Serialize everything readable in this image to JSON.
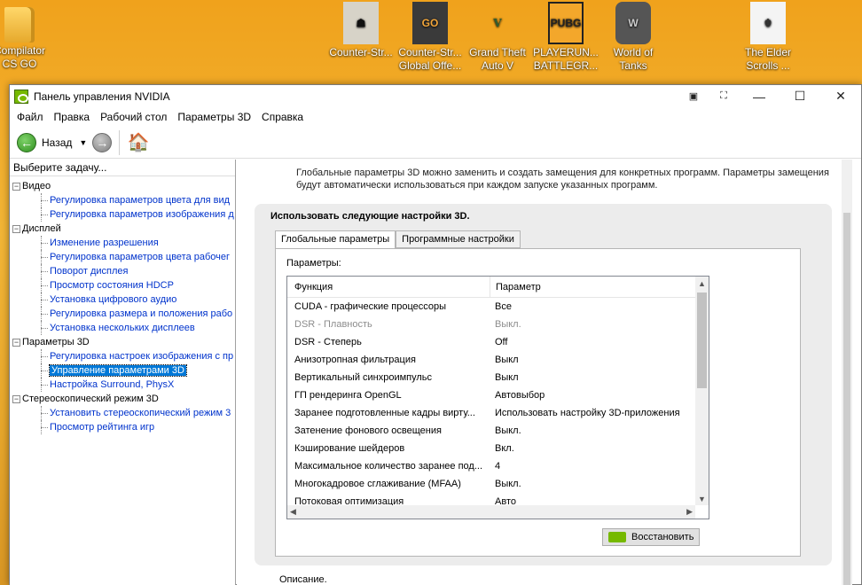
{
  "desktop": {
    "icons": [
      {
        "label": "Compilator\nCS GO",
        "icon": "folder-icon"
      },
      {
        "label": "Counter-Str...",
        "icon": "counter-strike-icon"
      },
      {
        "label": "Counter-Str...\nGlobal Offe...",
        "icon": "csgo-icon"
      },
      {
        "label": "Grand Theft\nAuto V",
        "icon": "gta-v-icon"
      },
      {
        "label": "PLAYERUN...\nBATTLEGR...",
        "icon": "pubg-icon"
      },
      {
        "label": "World of\nTanks",
        "icon": "world-of-tanks-icon"
      },
      {
        "label": "The Elder\nScrolls ...",
        "icon": "elder-scrolls-icon"
      }
    ]
  },
  "window": {
    "title": "Панель управления NVIDIA",
    "menu": [
      "Файл",
      "Правка",
      "Рабочий стол",
      "Параметры 3D",
      "Справка"
    ],
    "toolbar": {
      "back_label": "Назад"
    }
  },
  "left": {
    "header": "Выберите задачу...",
    "tree": [
      {
        "type": "cat",
        "label": "Видео"
      },
      {
        "type": "item",
        "label": "Регулировка параметров цвета для вид"
      },
      {
        "type": "item",
        "label": "Регулировка параметров изображения д"
      },
      {
        "type": "cat",
        "label": "Дисплей"
      },
      {
        "type": "item",
        "label": "Изменение разрешения"
      },
      {
        "type": "item",
        "label": "Регулировка параметров цвета рабочег"
      },
      {
        "type": "item",
        "label": "Поворот дисплея"
      },
      {
        "type": "item",
        "label": "Просмотр состояния HDCP"
      },
      {
        "type": "item",
        "label": "Установка цифрового аудио"
      },
      {
        "type": "item",
        "label": "Регулировка размера и положения рабо"
      },
      {
        "type": "item",
        "label": "Установка нескольких дисплеев"
      },
      {
        "type": "cat",
        "label": "Параметры 3D"
      },
      {
        "type": "item",
        "label": "Регулировка настроек изображения с пр"
      },
      {
        "type": "item",
        "label": "Управление параметрами 3D",
        "selected": true
      },
      {
        "type": "item",
        "label": "Настройка Surround, PhysX"
      },
      {
        "type": "cat",
        "label": "Стереоскопический режим 3D"
      },
      {
        "type": "item",
        "label": "Установить стереоскопический режим 3"
      },
      {
        "type": "item",
        "label": "Просмотр рейтинга игр"
      }
    ]
  },
  "right": {
    "description": "Глобальные параметры 3D можно заменить и создать замещения для конкретных программ. Параметры замещения будут автоматически использоваться при каждом запуске указанных программ.",
    "panel_title": "Использовать следующие настройки 3D.",
    "tabs": [
      "Глобальные параметры",
      "Программные настройки"
    ],
    "params_label": "Параметры:",
    "columns": [
      "Функция",
      "Параметр"
    ],
    "rows": [
      {
        "func": "CUDA - графические процессоры",
        "value": "Все",
        "dim": false
      },
      {
        "func": "DSR - Плавность",
        "value": "Выкл.",
        "dim": true
      },
      {
        "func": "DSR - Степерь",
        "value": "Off",
        "dim": false
      },
      {
        "func": "Анизотропная фильтрация",
        "value": "Выкл",
        "dim": false
      },
      {
        "func": "Вертикальный синхроимпульс",
        "value": "Выкл",
        "dim": false
      },
      {
        "func": "ГП рендеринга OpenGL",
        "value": "Автовыбор",
        "dim": false
      },
      {
        "func": "Заранее подготовленные кадры вирту...",
        "value": "Использовать настройку 3D-приложения",
        "dim": false
      },
      {
        "func": "Затенение фонового освещения",
        "value": "Выкл.",
        "dim": false
      },
      {
        "func": "Кэширование шейдеров",
        "value": "Вкл.",
        "dim": false
      },
      {
        "func": "Максимальное количество заранее под...",
        "value": "4",
        "dim": false
      },
      {
        "func": "Многокадровое сглаживание (MFAA)",
        "value": "Выкл.",
        "dim": false
      },
      {
        "func": "Потоковая оптимизация",
        "value": "Авто",
        "dim": false
      }
    ],
    "restore_label": "Восстановить",
    "bottom_label": "Описание."
  }
}
